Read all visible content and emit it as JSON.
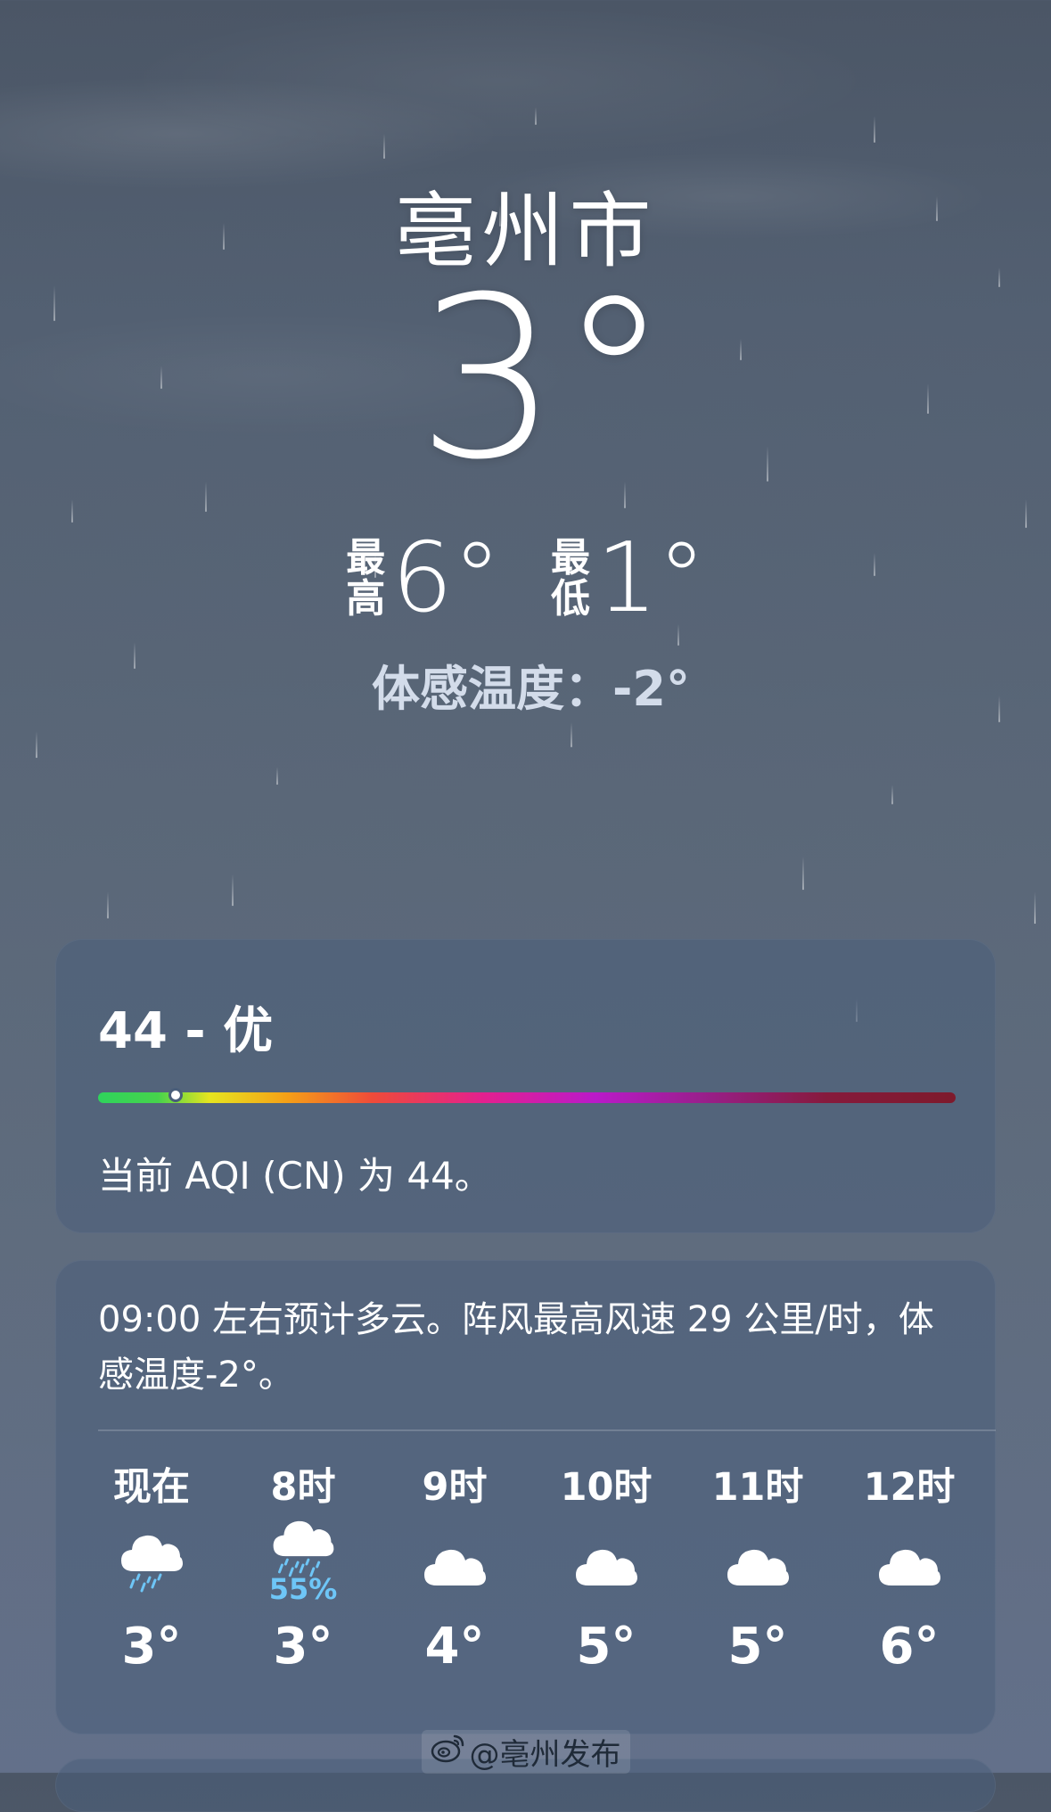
{
  "location": {
    "city": "亳州市"
  },
  "current": {
    "temperature": "3°",
    "high_label": "最高",
    "high_value": "6°",
    "low_label": "最低",
    "low_value": "1°",
    "feels_like": "体感温度：-2°"
  },
  "aqi": {
    "title": "44 - 优",
    "value": 44,
    "scale_position_fraction": 0.09,
    "description": "当前 AQI (CN) 为 44。"
  },
  "hourly": {
    "summary": "09:00 左右预计多云。阵风最高风速 29 公里/时，体感温度-2°。",
    "items": [
      {
        "label": "现在",
        "icon": "cloud-rain-icon",
        "precip": "",
        "temp": "3°"
      },
      {
        "label": "8时",
        "icon": "cloud-heavy-rain-icon",
        "precip": "55%",
        "temp": "3°"
      },
      {
        "label": "9时",
        "icon": "cloud-icon",
        "precip": "",
        "temp": "4°"
      },
      {
        "label": "10时",
        "icon": "cloud-icon",
        "precip": "",
        "temp": "5°"
      },
      {
        "label": "11时",
        "icon": "cloud-icon",
        "precip": "",
        "temp": "5°"
      },
      {
        "label": "12时",
        "icon": "cloud-icon",
        "precip": "",
        "temp": "6°"
      }
    ]
  },
  "watermark": {
    "text": "@亳州发布",
    "icon": "weibo-icon"
  },
  "colors": {
    "precip_text": "#6ec6f7",
    "card_bg": "#4a5e7a",
    "feels_like_text": "#d3dcea"
  }
}
